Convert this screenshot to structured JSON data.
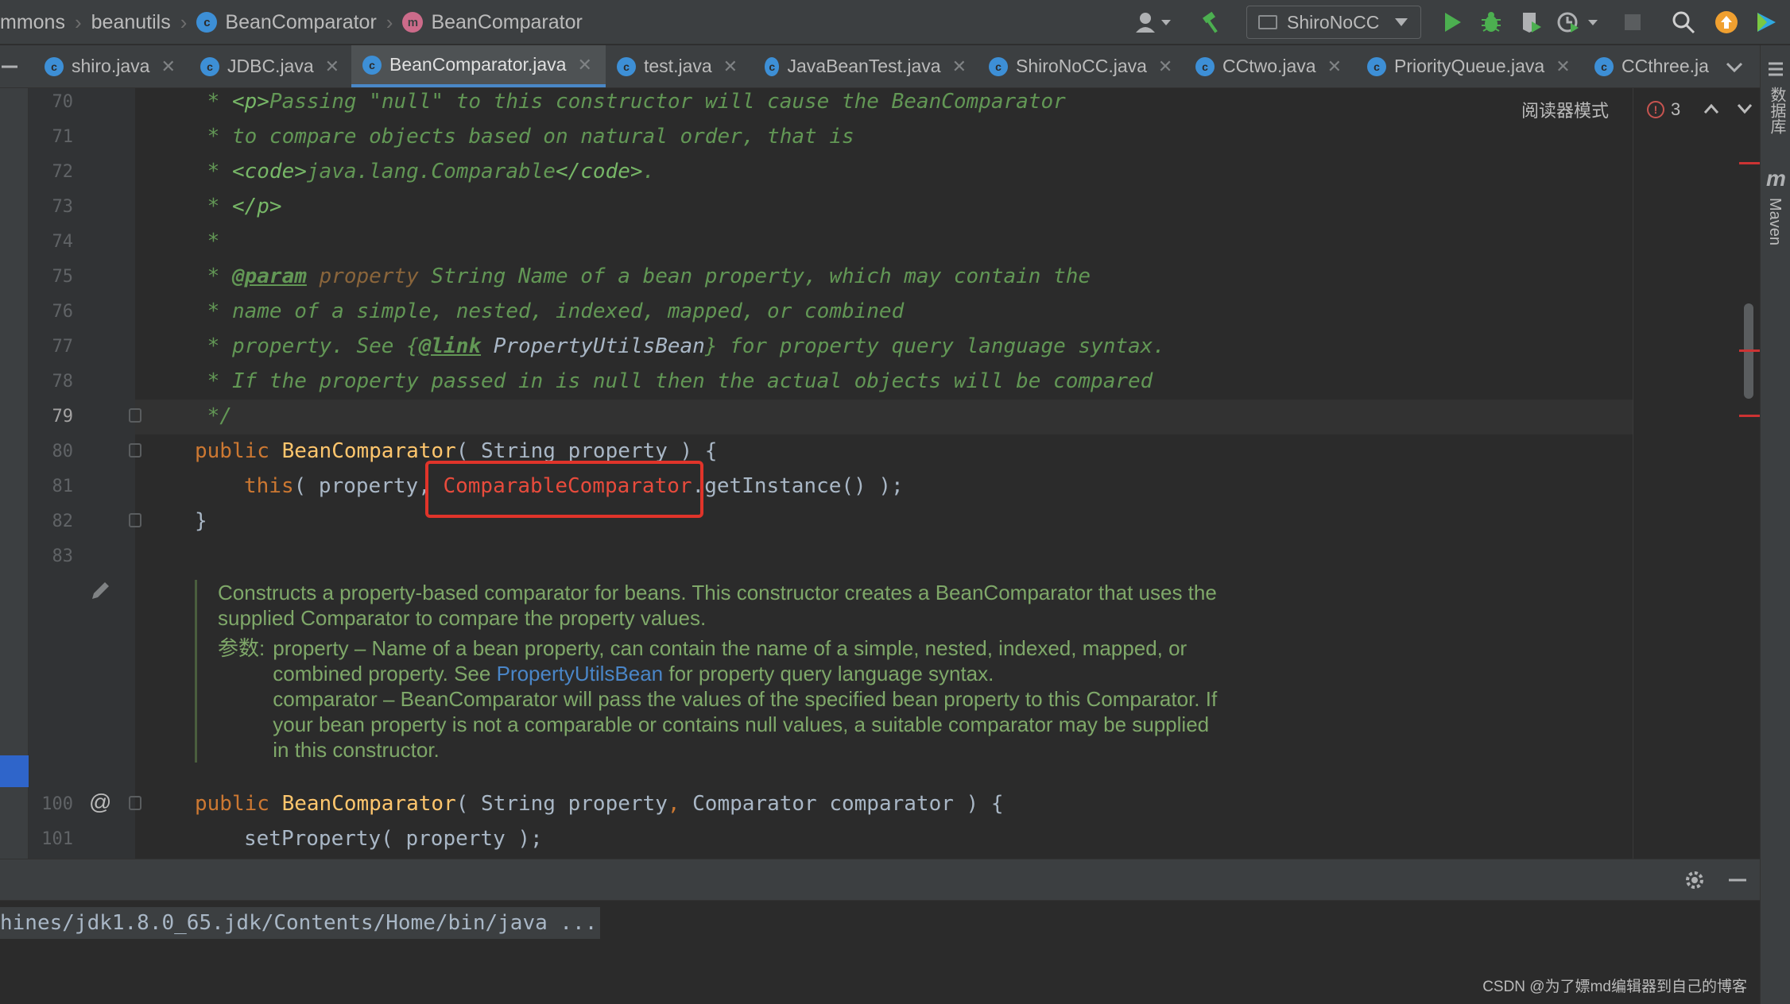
{
  "breadcrumb": {
    "items": [
      {
        "label": "mmons"
      },
      {
        "label": "beanutils"
      },
      {
        "label": "BeanComparator",
        "icon_letter": "c"
      },
      {
        "label": "BeanComparator",
        "icon_letter": "m"
      }
    ]
  },
  "toolbar": {
    "run_config": "ShiroNoCC",
    "icons": [
      "user-icon",
      "hammer-icon",
      "run-icon",
      "debug-icon",
      "coverage-icon",
      "profile-icon",
      "stop-icon",
      "search-icon",
      "update-icon",
      "plugin-icon"
    ]
  },
  "tabs": [
    {
      "label": "shiro.java",
      "active": false
    },
    {
      "label": "JDBC.java",
      "active": false
    },
    {
      "label": "BeanComparator.java",
      "active": true
    },
    {
      "label": "test.java",
      "active": false
    },
    {
      "label": "JavaBeanTest.java",
      "active": false
    },
    {
      "label": "ShiroNoCC.java",
      "active": false
    },
    {
      "label": "CCtwo.java",
      "active": false
    },
    {
      "label": "PriorityQueue.java",
      "active": false
    },
    {
      "label": "CCthree.ja",
      "active": false
    }
  ],
  "right_strip": {
    "database": "数据库",
    "maven": "Maven",
    "maven_icon": "m"
  },
  "editor_status": {
    "reader_mode": "阅读器模式",
    "error_count": "3",
    "error_icon": "!"
  },
  "line_numbers": [
    "70",
    "71",
    "72",
    "73",
    "74",
    "75",
    "76",
    "77",
    "78",
    "79",
    "80",
    "81",
    "82",
    "83",
    "100",
    "101"
  ],
  "code": {
    "l70_a": " * ",
    "l70_tag": "<p>",
    "l70_b": "Passing \"null\" to this constructor will cause the BeanComparator",
    "l71": " * to compare objects based on natural order, that is",
    "l72_a": " * ",
    "l72_tag1": "<code>",
    "l72_b": "java.lang.Comparable",
    "l72_tag2": "</code>",
    "l72_c": ".",
    "l73_a": " * ",
    "l73_tag": "</p>",
    "l74": " *",
    "l75_a": " * ",
    "l75_at": "@param",
    "l75_sp": " ",
    "l75_p": "property",
    "l75_b": " String Name of a bean property, which may contain the",
    "l76": " * name of a simple, nested, indexed, mapped, or combined",
    "l77_a": " * property. See {",
    "l77_at": "@link",
    "l77_ref": " PropertyUtilsBean",
    "l77_b": "} for property query language syntax.",
    "l78": " * If the property passed in is null then the actual objects will be compared",
    "l79": " */",
    "l80_kw": "public ",
    "l80_fn": "BeanComparator",
    "l80_b": "( String property ) {",
    "l81_kw": "this",
    "l81_b": "( property, ",
    "l81_hl": "ComparableComparator",
    "l81_c": ".getInstance() );",
    "l82": "}",
    "l83": "",
    "l100_kw": "public ",
    "l100_fn": "BeanComparator",
    "l100_b": "( String property",
    "l100_comma": ",",
    "l100_c": " Comparator comparator ) {",
    "l101_b": "setProperty( property );"
  },
  "gutter_marks": {
    "line100": "@"
  },
  "doc": {
    "desc": "Constructs a property-based comparator for beans. This constructor creates a BeanComparator that uses the supplied Comparator to compare the property values.",
    "params_label": "参数:",
    "param1_a": "property – Name of a bean property, can contain the name of a simple, nested, indexed, mapped, or combined property. See ",
    "param1_link": "PropertyUtilsBean",
    "param1_b": " for property query language syntax.",
    "param2": "comparator – BeanComparator will pass the values of the specified bean property to this Comparator. If your bean property is not a comparable or contains null values, a suitable comparator may be supplied in this constructor."
  },
  "run_panel": {
    "command": "hines/jdk1.8.0_65.jdk/Contents/Home/bin/java ..."
  },
  "watermark": "CSDN @为了嫖md编辑器到自己的博客",
  "colors": {
    "highlight_box": "#e0342a",
    "keyword": "#cc7832",
    "method": "#ffc66d",
    "comment": "#629755",
    "link": "#4a86c8"
  }
}
